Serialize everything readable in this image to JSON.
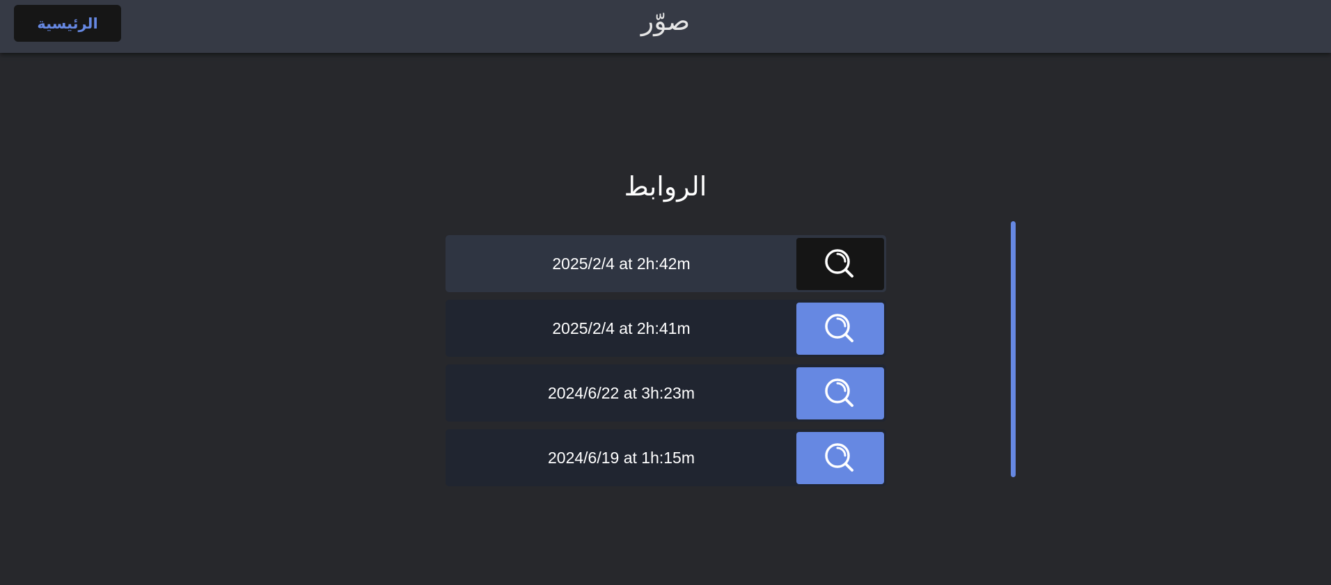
{
  "header": {
    "home_label": "الرئيسية",
    "app_title": "صوّر"
  },
  "main": {
    "title": "الروابط",
    "links": [
      {
        "label": "2025/2/4 at 2h:42m",
        "icon": "search-icon",
        "active": true
      },
      {
        "label": "2025/2/4 at 2h:41m",
        "icon": "search-icon",
        "active": false
      },
      {
        "label": "2024/6/22 at 3h:23m",
        "icon": "search-icon",
        "active": false
      },
      {
        "label": "2024/6/19 at 1h:15m",
        "icon": "search-icon",
        "active": false
      }
    ]
  },
  "colors": {
    "accent": "#6688e2",
    "background": "#27282c",
    "header": "#363a45",
    "row": "#202530",
    "row_active": "#2f3542",
    "button_active": "#151515"
  }
}
